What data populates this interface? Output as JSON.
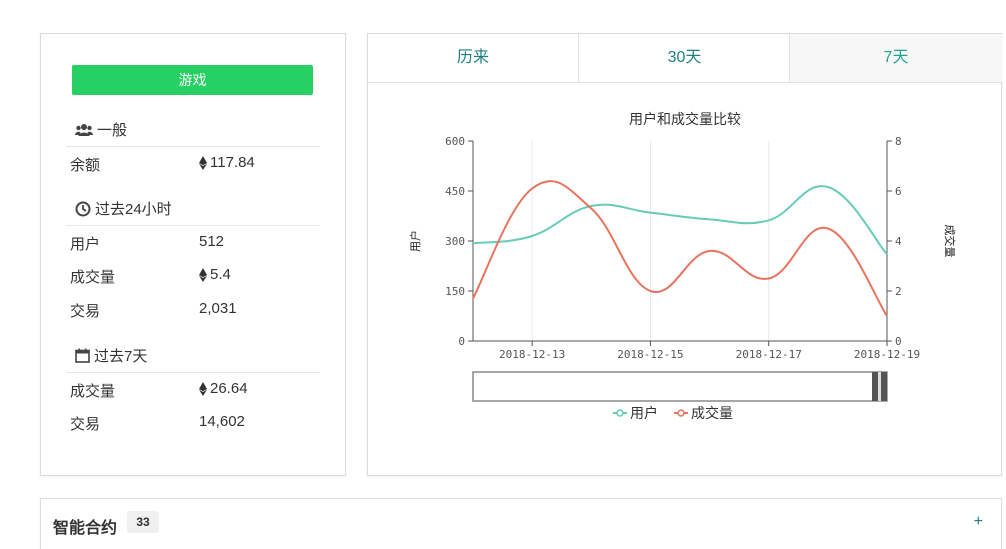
{
  "stats": {
    "game_button": "游戏",
    "general": {
      "title": "一般",
      "balance_label": "余额",
      "balance_value": "117.84"
    },
    "past24h": {
      "title": "过去24小时",
      "users_label": "用户",
      "users_value": "512",
      "volume_label": "成交量",
      "volume_value": "5.4",
      "tx_label": "交易",
      "tx_value": "2,031"
    },
    "past7d": {
      "title": "过去7天",
      "volume_label": "成交量",
      "volume_value": "26.64",
      "tx_label": "交易",
      "tx_value": "14,602"
    }
  },
  "tabs": [
    "历来",
    "30天",
    "7天"
  ],
  "active_tab": "7天",
  "contracts": {
    "title": "智能合约",
    "count": "33",
    "expand": "+"
  },
  "colors": {
    "users": "#66ccb8",
    "volume": "#e8735f",
    "game_button": "#26d062",
    "tab_text": "#1f7f7f"
  },
  "chart_data": {
    "type": "line",
    "title": "用户和成交量比较",
    "x": [
      "2018-12-12",
      "2018-12-13",
      "2018-12-14",
      "2018-12-15",
      "2018-12-16",
      "2018-12-17",
      "2018-12-18",
      "2018-12-19"
    ],
    "x_tick_labels": [
      "2018-12-13",
      "2018-12-15",
      "2018-12-17",
      "2018-12-19"
    ],
    "y_left": {
      "label": "用户",
      "min": 0,
      "max": 600,
      "ticks": [
        "0",
        "150",
        "300",
        "450",
        "600"
      ]
    },
    "y_right": {
      "label": "成交量",
      "min": 0,
      "max": 8,
      "ticks": [
        "0",
        "2",
        "4",
        "6",
        "8"
      ]
    },
    "series": [
      {
        "name": "用户",
        "axis": "left",
        "values": [
          293,
          315,
          405,
          385,
          365,
          362,
          462,
          260
        ]
      },
      {
        "name": "成交量",
        "axis": "right",
        "values": [
          1.7,
          6.1,
          5.3,
          2.0,
          3.6,
          2.5,
          4.5,
          1.0
        ]
      }
    ],
    "grid": "vertical",
    "legend": "bottom"
  }
}
